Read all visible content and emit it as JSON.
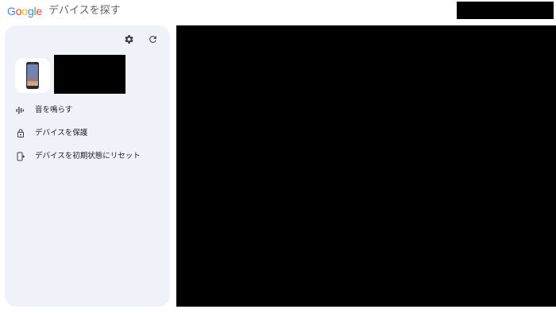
{
  "header": {
    "logo": {
      "letters": [
        "G",
        "o",
        "o",
        "g",
        "l",
        "e"
      ],
      "letter_colors": [
        "#4285F4",
        "#EA4335",
        "#FBBC05",
        "#4285F4",
        "#34A853",
        "#EA4335"
      ]
    },
    "title": "デバイスを探す"
  },
  "toolbar": {
    "settings_icon": "gear-icon",
    "refresh_icon": "refresh-icon"
  },
  "device": {
    "thumbnail_icon": "phone-icon"
  },
  "actions": [
    {
      "label": "音を鳴らす",
      "icon": "sound-wave-icon"
    },
    {
      "label": "デバイスを保護",
      "icon": "lock-icon"
    },
    {
      "label": "デバイスを初期状態にリセット",
      "icon": "reset-phone-icon"
    }
  ],
  "colors": {
    "panel_bg": "#eff2f8",
    "redaction": "#000000"
  }
}
